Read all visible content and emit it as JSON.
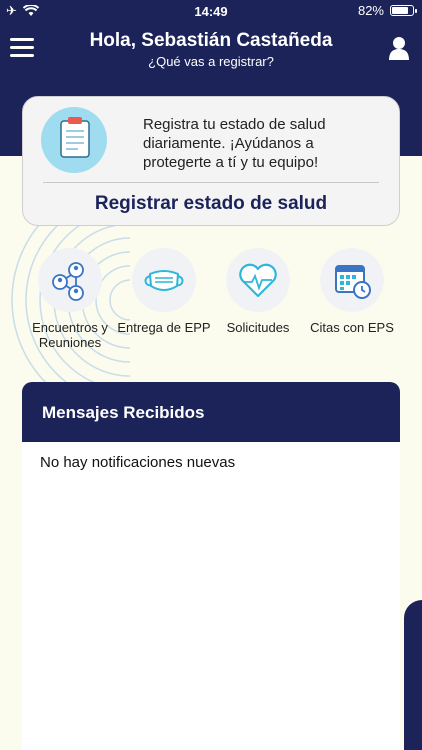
{
  "status_bar": {
    "time": "14:49",
    "battery": "82%",
    "battery_level": 0.82
  },
  "header": {
    "title": "Hola, Sebastián Castañeda",
    "subtitle": "¿Qué vas a registrar?"
  },
  "health_card": {
    "text": "Registra tu estado de salud diariamente. ¡Ayúdanos a protegerte a tí y tu equipo!",
    "button_label": "Registrar estado de salud"
  },
  "actions": [
    {
      "label": "Encuentros y Reuniones",
      "icon": "network-icon"
    },
    {
      "label": "Entrega de EPP",
      "icon": "mask-icon"
    },
    {
      "label": "Solicitudes",
      "icon": "heart-icon"
    },
    {
      "label": "Citas con EPS",
      "icon": "calendar-icon"
    }
  ],
  "messages": {
    "title": "Mensajes Recibidos",
    "empty_text": "No hay notificaciones nuevas"
  },
  "colors": {
    "primary": "#1b2359",
    "accent": "#2fb6d9",
    "background": "#fbfcee"
  }
}
